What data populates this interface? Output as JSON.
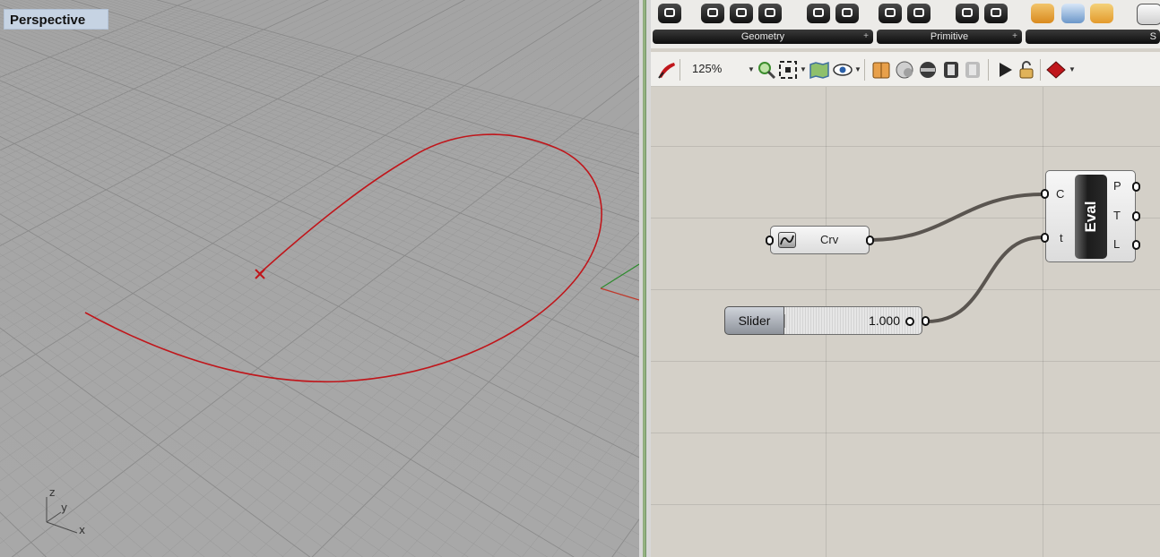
{
  "viewport": {
    "title": "Perspective",
    "axis_labels": {
      "z": "z",
      "y": "y",
      "x": "x"
    },
    "colors": {
      "curve": "#c0161b",
      "point_marker": "#c0161b",
      "world_x_axis": "#c0392b",
      "world_y_axis": "#2e8b2e"
    }
  },
  "ribbon": {
    "groups": [
      {
        "label": "Geometry",
        "pin": "+"
      },
      {
        "label": "Primitive",
        "pin": "+"
      },
      {
        "label": "S",
        "pin": ""
      }
    ]
  },
  "toolbar": {
    "zoom": "125%",
    "icons": [
      "sketch-pen-icon",
      "zoom-icon",
      "zoom-extents-icon",
      "map-icon",
      "preview-eye-icon",
      "box-icon",
      "cloud-icon",
      "wire-icon",
      "panel-icon",
      "panel-disabled-icon",
      "play-icon",
      "lock-icon",
      "preview-color-icon"
    ]
  },
  "canvas": {
    "curve_param": {
      "label": "Crv"
    },
    "slider": {
      "name": "Slider",
      "value": "1.000",
      "level": 1.0
    },
    "evaluate": {
      "label": "Eval",
      "inputs": [
        "C",
        "t"
      ],
      "outputs": [
        "P",
        "T",
        "L"
      ]
    }
  }
}
